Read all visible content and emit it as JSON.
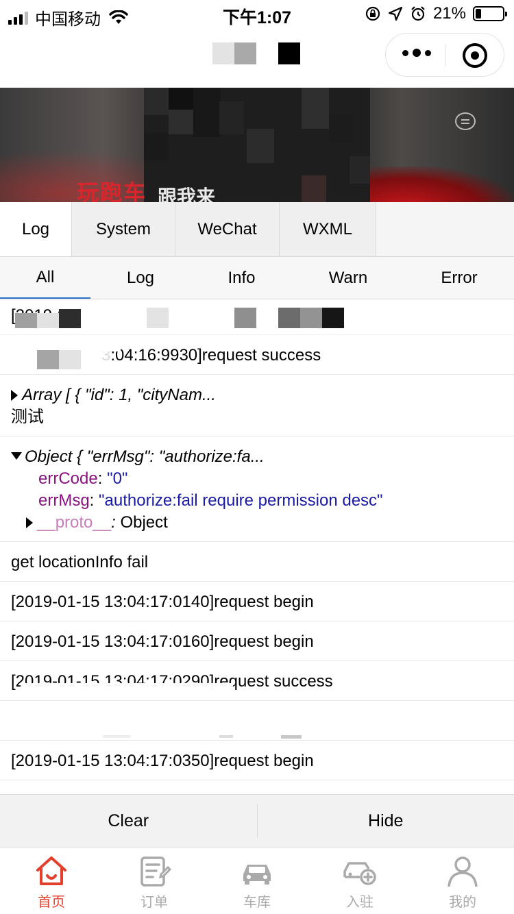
{
  "status_bar": {
    "carrier": "中国移动",
    "time": "下午1:07",
    "battery_percent": "21%",
    "battery_level": 0.21
  },
  "banner": {
    "text_red": "玩跑车",
    "text_white": "跟我来"
  },
  "console": {
    "tabs": [
      {
        "label": "Log",
        "active": true
      },
      {
        "label": "System",
        "active": false
      },
      {
        "label": "WeChat",
        "active": false
      },
      {
        "label": "WXML",
        "active": false
      }
    ],
    "filters": [
      {
        "label": "All",
        "active": true
      },
      {
        "label": "Log",
        "active": false
      },
      {
        "label": "Info",
        "active": false
      },
      {
        "label": "Warn",
        "active": false
      },
      {
        "label": "Error",
        "active": false
      }
    ]
  },
  "logs": {
    "row1_partial": "[2019-0",
    "row2_text": "3:04:16:9930]request success",
    "row3_array": "Array [ { \"id\": 1, \"cityNam...",
    "row3_text": "测试",
    "row4_object": "Object { \"errMsg\": \"authorize:fa...",
    "row4_errcode_key": "errCode",
    "row4_errcode_val": "\"0\"",
    "row4_errmsg_key": "errMsg",
    "row4_errmsg_val": "\"authorize:fail require permission desc\"",
    "row4_proto_key": "__proto__",
    "row4_proto_val": "Object",
    "row5_text": "get locationInfo fail",
    "row6_text": "[2019-01-15 13:04:17:0140]request begin",
    "row7_text": "[2019-01-15 13:04:17:0160]request begin",
    "row8_text": "[2019-01-15 13:04:17:0290]request success",
    "row10_text": "[2019-01-15 13:04:17:0350]request begin"
  },
  "toolbar": {
    "clear_label": "Clear",
    "hide_label": "Hide"
  },
  "tabbar": {
    "items": [
      {
        "label": "首页",
        "icon": "home-icon",
        "active": true
      },
      {
        "label": "订单",
        "icon": "order-icon",
        "active": false
      },
      {
        "label": "车库",
        "icon": "car-icon",
        "active": false
      },
      {
        "label": "入驻",
        "icon": "car-add-icon",
        "active": false
      },
      {
        "label": "我的",
        "icon": "user-icon",
        "active": false
      }
    ],
    "active_color": "#e2402c",
    "inactive_color": "#aaaaaa"
  }
}
